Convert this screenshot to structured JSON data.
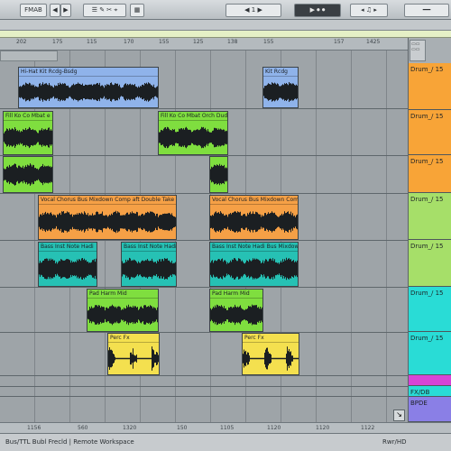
{
  "toolbar": {
    "left_button": "FMAB",
    "position": "1",
    "colors": {
      "bg": "#c8cdd0"
    }
  },
  "ruler": {
    "labels": [
      "202",
      "175",
      "115",
      "170",
      "155",
      "125",
      "138",
      "155",
      "157",
      "1425"
    ]
  },
  "bottom_ruler": {
    "labels": [
      "1156",
      "560",
      "1320",
      "150",
      "1105",
      "1120",
      "1120",
      "1122"
    ]
  },
  "tracks": [
    {
      "name": "Drum_/ 15",
      "color": "#f8a437"
    },
    {
      "name": "Drum_/ 15",
      "color": "#f8a437"
    },
    {
      "name": "Drum_/ 15",
      "color": "#f8a437"
    },
    {
      "name": "Drum_/ 15",
      "color": "#a6df69"
    },
    {
      "name": "Drum_/ 15",
      "color": "#a6df69"
    },
    {
      "name": "Drum_/ 15",
      "color": "#29dcd6"
    },
    {
      "name": "Drum_/ 15",
      "color": "#29dcd6"
    },
    {
      "name": "",
      "color": "#d843d6"
    },
    {
      "name": "FX/DB",
      "color": "#29dcd6"
    },
    {
      "name": "BPDE",
      "color": "#8a7fe6"
    }
  ],
  "clips": {
    "blue_a": "Hi-Hat Kit Rcdg-Bsdg",
    "blue_b": "Kit Rcdg",
    "green_a": "Fill Ko Co Mbat e Mcuh",
    "green_b": "Fill Ko Co Mbat Orch Duds",
    "orange_a": "Vocal Chorus Bus Mixdown Comp aft Double Take",
    "orange_b": "Vocal Chorus Bus Mixdown Comp",
    "teal_a": "Bass Inst Note Hadi",
    "teal_b": "Bass Inst Note Hadi",
    "teal_c": "Bass Inst Note Hadi Bus Mixdown Comp",
    "green_c": "Pad Harm Mid",
    "green_d": "Pad Harm Mid",
    "yellow_a": "Perc Fx",
    "yellow_b": "Perc Fx"
  },
  "status": {
    "left": "Bus/TTL Bubl Frecld | Remote Workspace",
    "right": "Rwr/HD"
  }
}
